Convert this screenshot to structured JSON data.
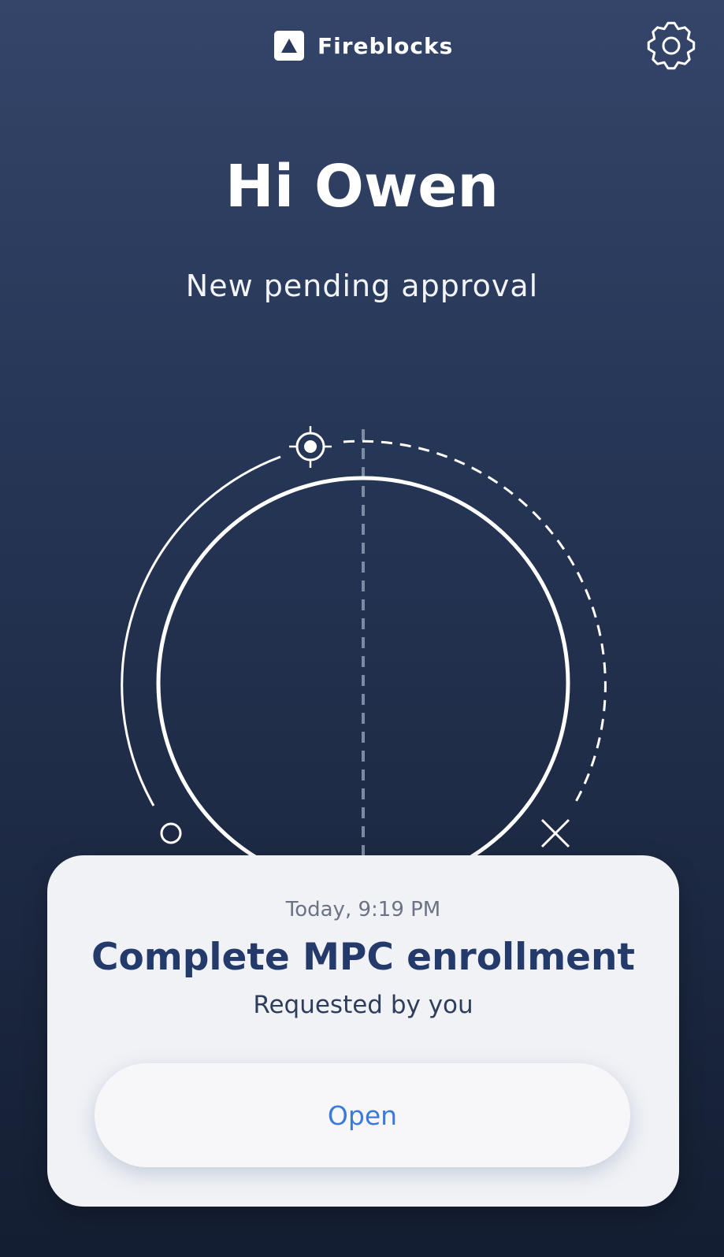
{
  "header": {
    "brand_name": "Fireblocks",
    "logo_icon": "fireblocks-triangle-logo",
    "settings_icon": "gear-icon"
  },
  "greeting": "Hi Owen",
  "status_text": "New pending approval",
  "dial": {
    "icons": [
      "crosshair-icon",
      "circle-icon",
      "close-icon"
    ]
  },
  "approval_card": {
    "timestamp": "Today, 9:19 PM",
    "title": "Complete MPC enrollment",
    "requester": "Requested by you",
    "open_label": "Open"
  },
  "colors": {
    "background_top": "#34456a",
    "background_bottom": "#141e32",
    "card_background": "#f1f2f6",
    "title_color": "#233a6b",
    "link_color": "#3a7ad8"
  }
}
